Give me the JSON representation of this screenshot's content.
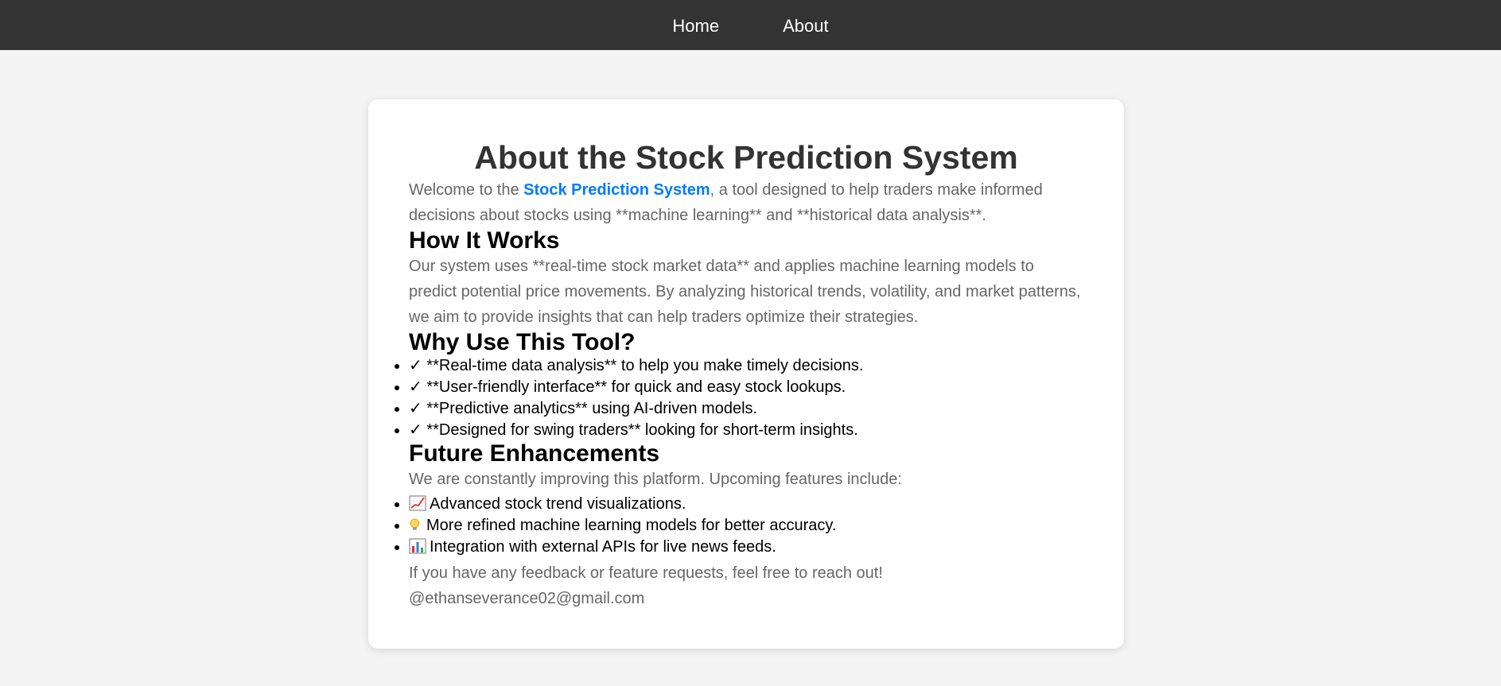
{
  "nav": {
    "home_label": "Home",
    "about_label": "About"
  },
  "colors": {
    "navbar": "#333333",
    "accent": "#007bff",
    "page_bg": "#f4f4f4",
    "body_text": "#666666",
    "heading": "#333333"
  },
  "page": {
    "title": "About the Stock Prediction System",
    "intro_before": "Welcome to the ",
    "intro_highlight": "Stock Prediction System",
    "intro_after": ", a tool designed to help traders make informed decisions about stocks using **machine learning** and **historical data analysis**.",
    "how_heading": "How It Works",
    "how_text": "Our system uses **real-time stock market data** and applies machine learning models to predict potential price movements. By analyzing historical trends, volatility, and market patterns, we aim to provide insights that can help traders optimize their strategies.",
    "why_heading": "Why Use This Tool?",
    "why_items": [
      {
        "check": "✓",
        "text": " **Real-time data analysis** to help you make timely decisions."
      },
      {
        "check": "✓",
        "text": " **User-friendly interface** for quick and easy stock lookups."
      },
      {
        "check": "✓",
        "text": " **Predictive analytics** using AI-driven models."
      },
      {
        "check": "✓",
        "text": " **Designed for swing traders** looking for short-term insights."
      }
    ],
    "future_heading": "Future Enhancements",
    "future_intro": "We are constantly improving this platform. Upcoming features include:",
    "future_items": [
      {
        "icon": "chart-increasing-icon",
        "text": "Advanced stock trend visualizations."
      },
      {
        "icon": "light-bulb-icon",
        "text": "More refined machine learning models for better accuracy."
      },
      {
        "icon": "bar-chart-icon",
        "text": "Integration with external APIs for live news feeds."
      }
    ],
    "contact_text": "If you have any feedback or feature requests, feel free to reach out!",
    "contact_email": "@ethanseverance02@gmail.com"
  }
}
